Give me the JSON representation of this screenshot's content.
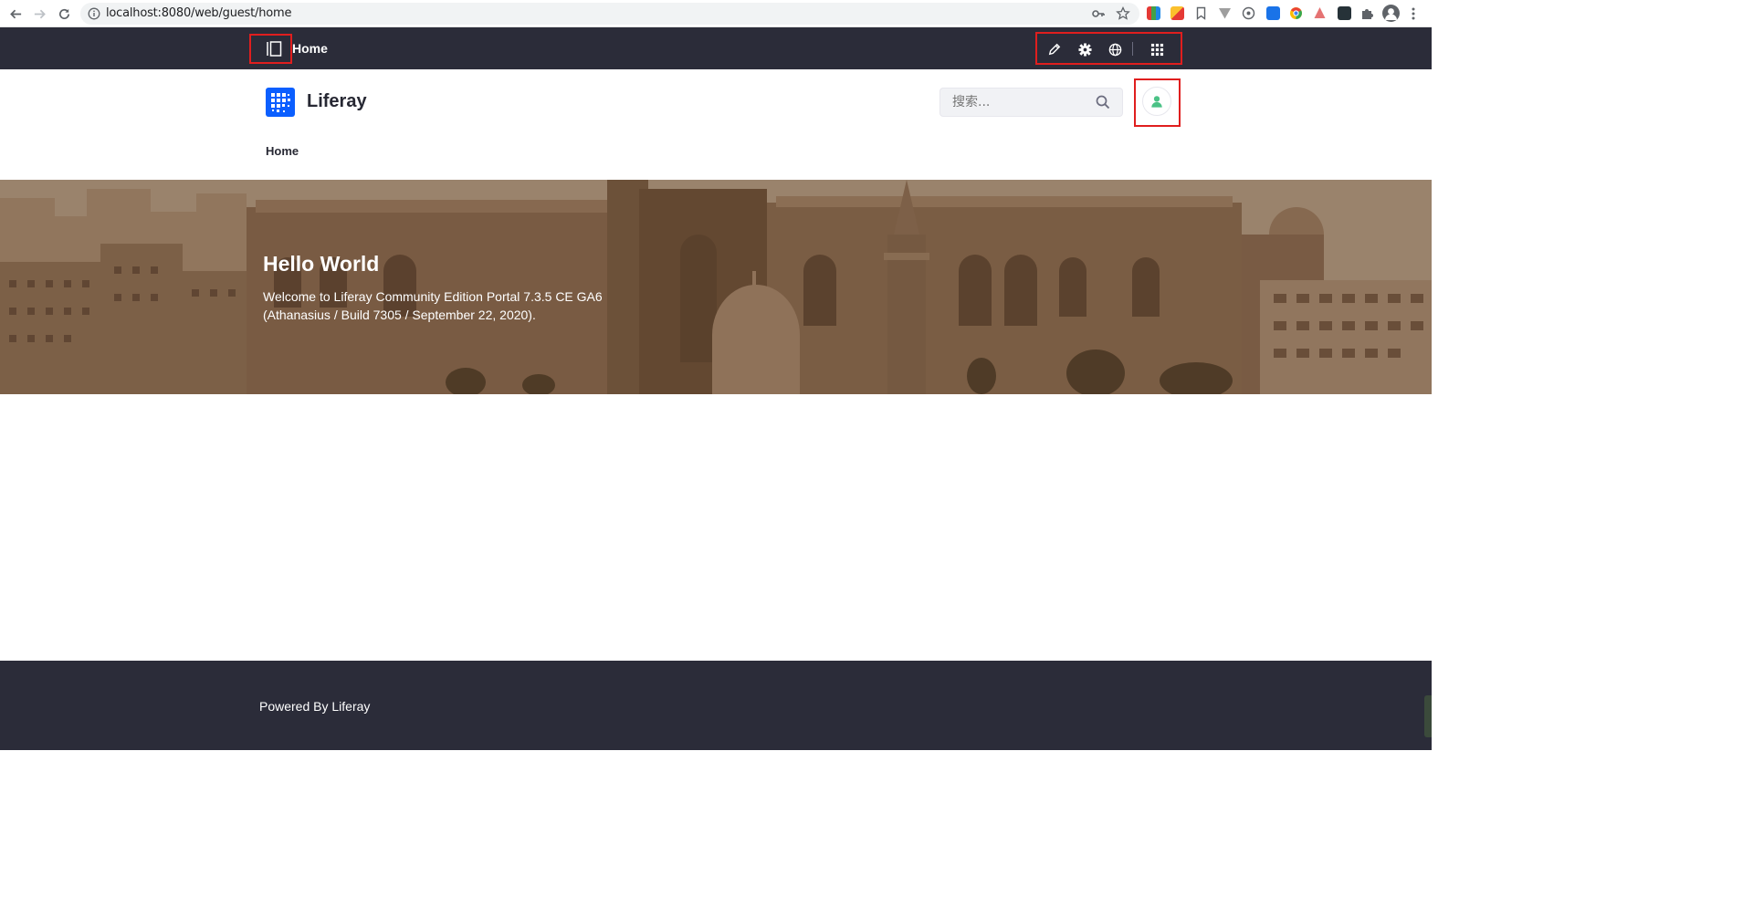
{
  "browser": {
    "url": "localhost:8080/web/guest/home"
  },
  "control_menu": {
    "title": "Home",
    "icons": [
      "product-menu-toggle-icon",
      "edit-icon",
      "gear-icon",
      "globe-icon",
      "apps-grid-icon"
    ]
  },
  "site": {
    "name": "Liferay",
    "search_placeholder": "搜索...",
    "nav": [
      "Home"
    ]
  },
  "banner": {
    "title": "Hello World",
    "text": "Welcome to Liferay Community Edition Portal 7.3.5 CE GA6 (Athanasius / Build 7305 / September 22, 2020)."
  },
  "footer": {
    "text": "Powered By Liferay"
  },
  "colors": {
    "control_menu_bg": "#2b2c39",
    "highlight_border": "#e01e1e",
    "logo_blue": "#0b5fff",
    "avatar_green": "#4bc286"
  }
}
